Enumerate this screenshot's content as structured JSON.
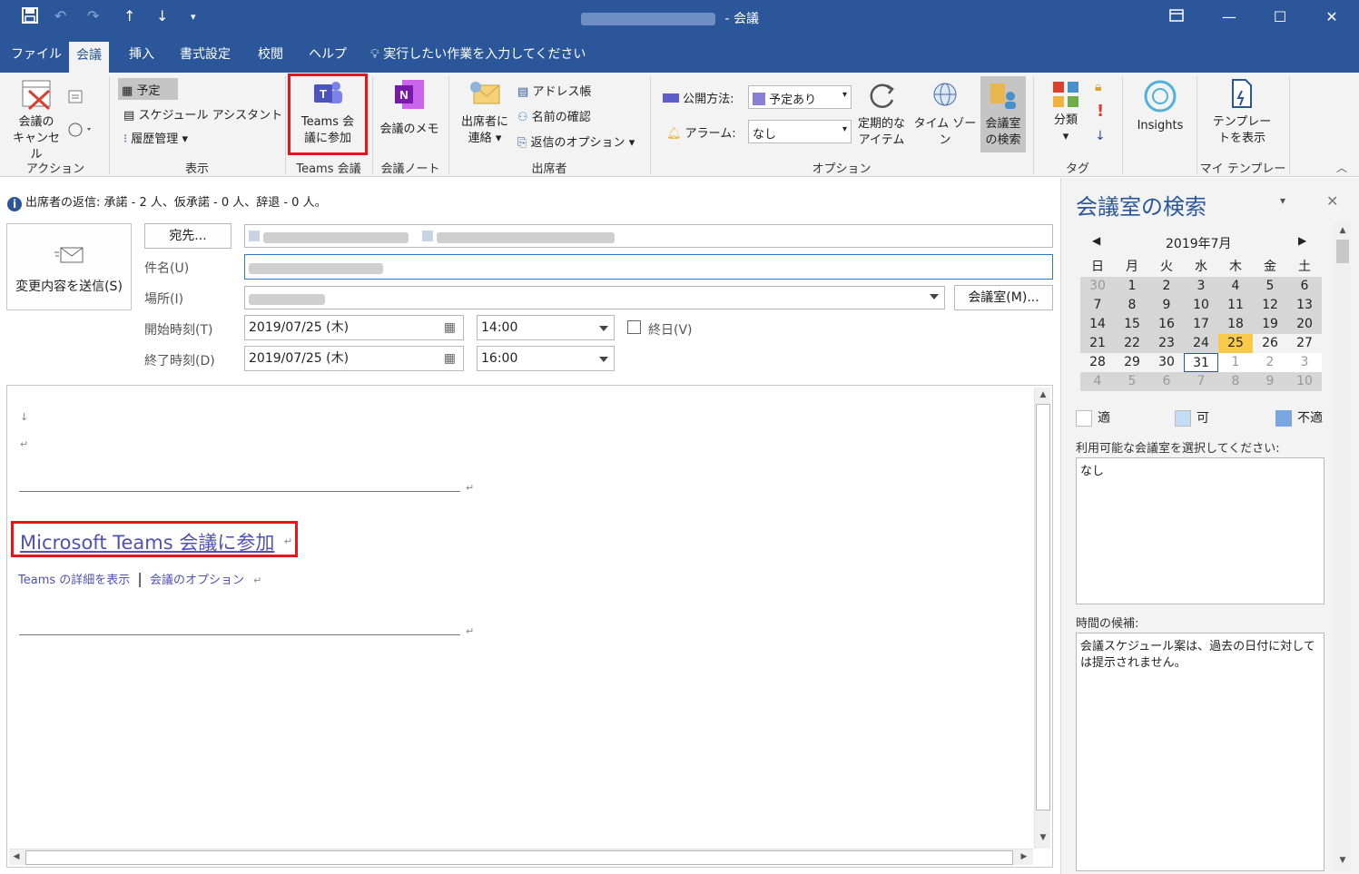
{
  "window": {
    "title_suffix": "- 会議",
    "controls": [
      "restore-ribbon",
      "minimize",
      "maximize",
      "close"
    ]
  },
  "quick_access": {
    "icons": [
      "save-icon",
      "undo-icon",
      "redo-icon",
      "up-arrow-icon",
      "down-arrow-icon",
      "customize-icon"
    ]
  },
  "tabs": [
    {
      "label": "ファイル"
    },
    {
      "label": "会議",
      "active": true
    },
    {
      "label": "挿入"
    },
    {
      "label": "書式設定"
    },
    {
      "label": "校閲"
    },
    {
      "label": "ヘルプ"
    }
  ],
  "tell_me": "実行したい作業を入力してください",
  "ribbon": {
    "action": {
      "cancel_label_1": "会議の",
      "cancel_label_2": "キャンセル",
      "group_label": "アクション"
    },
    "show": {
      "appointment": "予定",
      "scheduling": "スケジュール アシスタント",
      "tracking": "履歴管理",
      "group_label": "表示"
    },
    "teams": {
      "join_label_1": "Teams 会",
      "join_label_2": "議に参加",
      "group_label": "Teams 会議"
    },
    "onenote": {
      "notes_label": "会議のメモ",
      "group_label": "会議ノート"
    },
    "attendees": {
      "contact_label_1": "出席者に",
      "contact_label_2": "連絡",
      "address_book": "アドレス帳",
      "check_names": "名前の確認",
      "response_options": "返信のオプション",
      "group_label": "出席者"
    },
    "options": {
      "show_as_label": "公開方法:",
      "show_as_value": "予定あり",
      "reminder_label": "アラーム:",
      "reminder_value": "なし",
      "recurrence_1": "定期的な",
      "recurrence_2": "アイテム",
      "timezone": "タイム ゾーン",
      "room_finder_1": "会議室",
      "room_finder_2": "の検索",
      "group_label": "オプション"
    },
    "tags": {
      "categorize": "分類",
      "group_label": "タグ"
    },
    "insights": {
      "label": "Insights"
    },
    "templates": {
      "label_1": "テンプレー",
      "label_2": "トを表示",
      "group_label": "マイ テンプレート"
    }
  },
  "info": {
    "text": "出席者の返信: 承諾 - 2 人、仮承諾 - 0 人、辞退 - 0 人。"
  },
  "form": {
    "send_label": "変更内容を送信(S)",
    "to_button": "宛先...",
    "subject_label": "件名(U)",
    "location_label": "場所(I)",
    "room_button": "会議室(M)...",
    "start_label": "開始時刻(T)",
    "start_date": "2019/07/25 (木)",
    "start_time": "14:00",
    "all_day_label": "終日(V)",
    "end_label": "終了時刻(D)",
    "end_date": "2019/07/25 (木)",
    "end_time": "16:00"
  },
  "body": {
    "teams_link": "Microsoft Teams 会議に参加",
    "learn_more": "Teams の詳細を表示",
    "meeting_options": "会議のオプション",
    "separator": "|"
  },
  "room_finder": {
    "title": "会議室の検索",
    "month": "2019年7月",
    "weekdays": [
      "日",
      "月",
      "火",
      "水",
      "木",
      "金",
      "土"
    ],
    "weeks": [
      [
        "30",
        "1",
        "2",
        "3",
        "4",
        "5",
        "6"
      ],
      [
        "7",
        "8",
        "9",
        "10",
        "11",
        "12",
        "13"
      ],
      [
        "14",
        "15",
        "16",
        "17",
        "18",
        "19",
        "20"
      ],
      [
        "21",
        "22",
        "23",
        "24",
        "25",
        "26",
        "27"
      ],
      [
        "28",
        "29",
        "30",
        "31",
        "1",
        "2",
        "3"
      ],
      [
        "4",
        "5",
        "6",
        "7",
        "8",
        "9",
        "10"
      ]
    ],
    "legend_good": "適",
    "legend_fair": "可",
    "legend_poor": "不適",
    "rooms_prompt": "利用可能な会議室を選択してください:",
    "rooms_value": "なし",
    "suggested_label": "時間の候補:",
    "suggested_text": "会議スケジュール案は、過去の日付に対しては提示されません。"
  },
  "colors": {
    "accent": "#2b579a",
    "highlight_frame": "#e8131b",
    "today": "#f8c94a",
    "teams_purple": "#4f52b2"
  }
}
